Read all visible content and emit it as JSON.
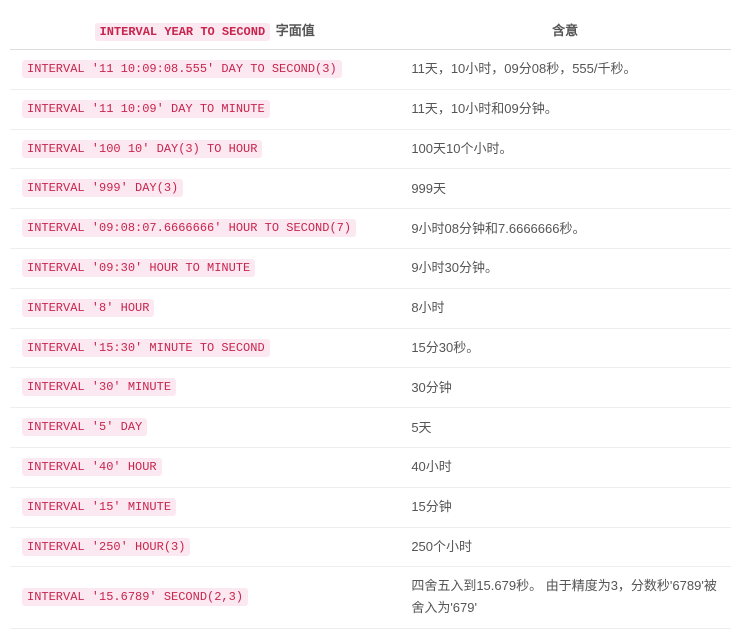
{
  "header": {
    "col1_code": "INTERVAL YEAR TO SECOND",
    "col1_suffix": "字面值",
    "col2": "含意"
  },
  "rows": [
    {
      "literal": "INTERVAL '11 10:09:08.555' DAY TO SECOND(3)",
      "meaning": "11天，10小时，09分08秒，555/千秒。"
    },
    {
      "literal": "INTERVAL '11 10:09' DAY TO MINUTE",
      "meaning": "11天，10小时和09分钟。"
    },
    {
      "literal": "INTERVAL '100 10' DAY(3) TO HOUR",
      "meaning": "100天10个小时。"
    },
    {
      "literal": "INTERVAL '999' DAY(3)",
      "meaning": "999天"
    },
    {
      "literal": "INTERVAL '09:08:07.6666666' HOUR TO SECOND(7)",
      "meaning": "9小时08分钟和7.6666666秒。"
    },
    {
      "literal": "INTERVAL '09:30' HOUR TO MINUTE",
      "meaning": "9小时30分钟。"
    },
    {
      "literal": "INTERVAL '8' HOUR",
      "meaning": "8小时"
    },
    {
      "literal": "INTERVAL '15:30' MINUTE TO SECOND",
      "meaning": "15分30秒。"
    },
    {
      "literal": "INTERVAL '30' MINUTE",
      "meaning": "30分钟"
    },
    {
      "literal": "INTERVAL '5' DAY",
      "meaning": "5天"
    },
    {
      "literal": "INTERVAL '40' HOUR",
      "meaning": "40小时"
    },
    {
      "literal": "INTERVAL '15' MINUTE",
      "meaning": "15分钟"
    },
    {
      "literal": "INTERVAL '250' HOUR(3)",
      "meaning": "250个小时"
    },
    {
      "literal": "INTERVAL '15.6789' SECOND(2,3)",
      "meaning": "四舍五入到15.679秒。 由于精度为3，分数秒'6789'被舍入为'679'"
    }
  ]
}
